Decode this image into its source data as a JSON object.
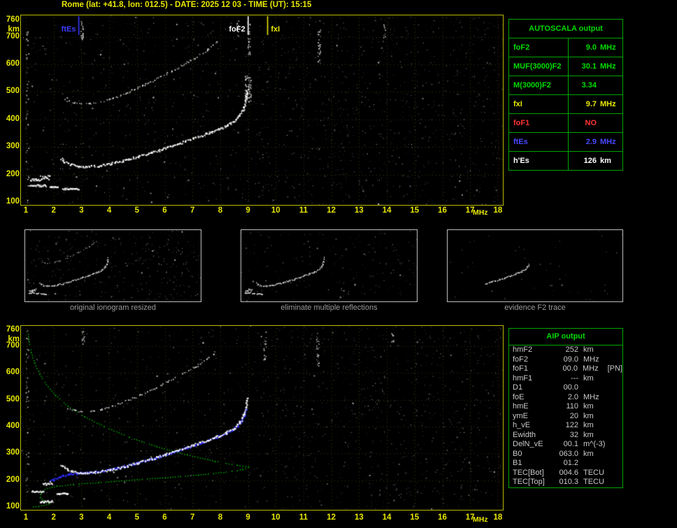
{
  "title": "Rome (lat: +41.8, lon: 012.5) - DATE: 2025 12 03 - TIME (UT): 15:15",
  "autoscala_table": {
    "header": "AUTOSCALA output",
    "rows": [
      {
        "label": "foF2",
        "value": "9.0",
        "unit": "MHz",
        "color": "#00dd00"
      },
      {
        "label": "MUF(3000)F2",
        "value": "30.1",
        "unit": "MHz",
        "color": "#00dd00"
      },
      {
        "label": "M(3000)F2",
        "value": "3.34",
        "unit": "",
        "color": "#00dd00"
      },
      {
        "label": "fxI",
        "value": "9.7",
        "unit": "MHz",
        "color": "#e8e800"
      },
      {
        "label": "foF1",
        "value": "NO",
        "unit": "",
        "color": "#ff3434"
      },
      {
        "label": "ftEs",
        "value": "2.9",
        "unit": "MHz",
        "color": "#4848ff"
      },
      {
        "label": "h'Es",
        "value": "126",
        "unit": "km",
        "color": "#ffffff"
      }
    ]
  },
  "aip_table": {
    "header": "AIP output",
    "rows": [
      {
        "label": "hmF2",
        "value": "252",
        "unit": "km",
        "note": ""
      },
      {
        "label": "foF2",
        "value": "09.0",
        "unit": "MHz",
        "note": ""
      },
      {
        "label": "foF1",
        "value": "00.0",
        "unit": "MHz",
        "note": "[PN]"
      },
      {
        "label": "hmF1",
        "value": "---",
        "unit": "km",
        "note": ""
      },
      {
        "label": "D1",
        "value": "00.0",
        "unit": "",
        "note": ""
      },
      {
        "label": "foE",
        "value": "2.0",
        "unit": "MHz",
        "note": ""
      },
      {
        "label": "hmE",
        "value": "110",
        "unit": "km",
        "note": ""
      },
      {
        "label": "ymE",
        "value": "20",
        "unit": "km",
        "note": ""
      },
      {
        "label": "h_vE",
        "value": "122",
        "unit": "km",
        "note": ""
      },
      {
        "label": "Ewidth",
        "value": "32",
        "unit": "km",
        "note": ""
      },
      {
        "label": "DelN_vE",
        "value": "00.1",
        "unit": "m^(-3)",
        "note": ""
      },
      {
        "label": "B0",
        "value": "063.0",
        "unit": "km",
        "note": ""
      },
      {
        "label": "B1",
        "value": "01.2",
        "unit": "",
        "note": ""
      },
      {
        "label": "TEC[Bot]",
        "value": "004.6",
        "unit": "TECU",
        "note": ""
      },
      {
        "label": "TEC[Top]",
        "value": "010.3",
        "unit": "TECU",
        "note": ""
      }
    ]
  },
  "thumbnails": [
    {
      "caption": "original ionogram resized"
    },
    {
      "caption": "eliminate multiple reflections"
    },
    {
      "caption": "evidence F2 trace"
    }
  ],
  "chart_data": [
    {
      "id": "top-ionogram",
      "type": "scatter",
      "xlabel": "MHz",
      "ylabel": "km",
      "x_range": [
        1,
        18
      ],
      "y_range": [
        100,
        760
      ],
      "x_ticks": [
        1,
        2,
        3,
        4,
        5,
        6,
        7,
        8,
        9,
        10,
        11,
        12,
        13,
        14,
        15,
        16,
        17,
        18
      ],
      "y_ticks": [
        100,
        200,
        300,
        400,
        500,
        600,
        700,
        760
      ],
      "grid": true,
      "markers": [
        {
          "label": "ftEs",
          "f": 2.9,
          "color": "#3c3cff"
        },
        {
          "label": "foF2",
          "f": 9.0,
          "color": "#ffffff"
        },
        {
          "label": "fxI",
          "f": 9.7,
          "color": "#e8e800"
        }
      ],
      "colors": {
        "trace": "#ffffff"
      },
      "traces": {
        "f_trace": [
          [
            2.25,
            260
          ],
          [
            2.4,
            246
          ],
          [
            2.6,
            237
          ],
          [
            2.9,
            231
          ],
          [
            3.2,
            230
          ],
          [
            3.6,
            233
          ],
          [
            4.0,
            240
          ],
          [
            4.5,
            252
          ],
          [
            5.0,
            266
          ],
          [
            5.5,
            281
          ],
          [
            6.0,
            297
          ],
          [
            6.5,
            314
          ],
          [
            7.0,
            332
          ],
          [
            7.5,
            350
          ],
          [
            7.9,
            365
          ],
          [
            8.2,
            379
          ],
          [
            8.5,
            397
          ],
          [
            8.7,
            419
          ],
          [
            8.85,
            448
          ],
          [
            8.93,
            482
          ],
          [
            8.97,
            512
          ]
        ],
        "second_hop": [
          [
            2.4,
            472
          ],
          [
            2.7,
            462
          ],
          [
            3.0,
            457
          ],
          [
            3.3,
            459
          ],
          [
            3.7,
            466
          ],
          [
            4.1,
            478
          ],
          [
            4.6,
            497
          ],
          [
            5.1,
            519
          ],
          [
            5.6,
            543
          ],
          [
            6.1,
            569
          ],
          [
            6.6,
            597
          ],
          [
            7.1,
            626
          ],
          [
            7.5,
            652
          ],
          [
            7.85,
            682
          ]
        ],
        "es_segments": [
          [
            1.12,
            1.72,
            162,
            3
          ],
          [
            1.85,
            2.15,
            157,
            2
          ],
          [
            1.5,
            1.85,
            191,
            6
          ],
          [
            2.3,
            2.9,
            150,
            2
          ],
          [
            1.15,
            1.5,
            183,
            3
          ]
        ],
        "spread": [
          8.88,
          9.1,
          465,
          560
        ]
      },
      "noise": {
        "seed": 20251203,
        "count": 1150,
        "right_extra": 420,
        "columns": [
          [
            3.0,
            690,
            760,
            20
          ],
          [
            9.02,
            630,
            760,
            26
          ],
          [
            11.55,
            610,
            760,
            30
          ],
          [
            1.04,
            100,
            760,
            45
          ],
          [
            8.6,
            700,
            760,
            12
          ],
          [
            13.9,
            680,
            760,
            10
          ]
        ]
      }
    },
    {
      "id": "bottom-ionogram",
      "type": "scatter",
      "xlabel": "MHz",
      "ylabel": "km",
      "x_range": [
        1,
        18
      ],
      "y_range": [
        100,
        760
      ],
      "x_ticks": [
        1,
        2,
        3,
        4,
        5,
        6,
        7,
        8,
        9,
        10,
        11,
        12,
        13,
        14,
        15,
        16,
        17,
        18
      ],
      "y_ticks": [
        100,
        200,
        300,
        400,
        500,
        600,
        700,
        760
      ],
      "grid": true,
      "colors": {
        "trace": "#ffffff",
        "profile": "#00bb00",
        "model": "#2d2dff"
      },
      "traces": {
        "f_trace": [
          [
            2.25,
            260
          ],
          [
            2.4,
            246
          ],
          [
            2.6,
            237
          ],
          [
            2.9,
            231
          ],
          [
            3.2,
            230
          ],
          [
            3.6,
            233
          ],
          [
            4.0,
            240
          ],
          [
            4.5,
            252
          ],
          [
            5.0,
            266
          ],
          [
            5.5,
            281
          ],
          [
            6.0,
            297
          ],
          [
            6.5,
            314
          ],
          [
            7.0,
            332
          ],
          [
            7.5,
            350
          ],
          [
            7.9,
            365
          ],
          [
            8.2,
            379
          ],
          [
            8.5,
            397
          ],
          [
            8.7,
            419
          ],
          [
            8.85,
            448
          ],
          [
            8.93,
            482
          ],
          [
            8.97,
            512
          ]
        ],
        "second_hop": [
          [
            2.4,
            472
          ],
          [
            2.7,
            462
          ],
          [
            3.0,
            457
          ],
          [
            3.3,
            459
          ],
          [
            3.7,
            466
          ],
          [
            4.1,
            478
          ],
          [
            4.6,
            497
          ],
          [
            5.1,
            519
          ],
          [
            5.6,
            543
          ],
          [
            6.1,
            569
          ],
          [
            6.6,
            597
          ],
          [
            7.1,
            626
          ],
          [
            7.5,
            652
          ],
          [
            7.85,
            682
          ]
        ],
        "es_segments": [
          [
            1.5,
            1.95,
            122,
            3
          ],
          [
            1.2,
            1.62,
            160,
            2
          ],
          [
            1.6,
            1.95,
            190,
            5
          ],
          [
            2.1,
            2.5,
            152,
            2
          ]
        ],
        "model_trace": [
          [
            1.85,
            198
          ],
          [
            2.0,
            204
          ],
          [
            2.2,
            214
          ],
          [
            2.5,
            223
          ],
          [
            2.9,
            228
          ],
          [
            3.3,
            230
          ],
          [
            3.8,
            237
          ],
          [
            4.3,
            248
          ],
          [
            4.8,
            261
          ],
          [
            5.3,
            275
          ],
          [
            5.8,
            290
          ],
          [
            6.3,
            306
          ],
          [
            6.8,
            324
          ],
          [
            7.3,
            342
          ],
          [
            7.8,
            360
          ],
          [
            8.2,
            376
          ],
          [
            8.5,
            394
          ],
          [
            8.7,
            415
          ],
          [
            8.85,
            442
          ],
          [
            8.93,
            470
          ]
        ],
        "profile": [
          [
            1.06,
            757
          ],
          [
            1.1,
            718
          ],
          [
            1.18,
            678
          ],
          [
            1.3,
            638
          ],
          [
            1.48,
            598
          ],
          [
            1.72,
            558
          ],
          [
            2.05,
            518
          ],
          [
            2.5,
            478
          ],
          [
            3.1,
            438
          ],
          [
            3.8,
            402
          ],
          [
            4.7,
            362
          ],
          [
            5.7,
            327
          ],
          [
            6.8,
            296
          ],
          [
            7.8,
            272
          ],
          [
            8.6,
            257
          ],
          [
            9.0,
            251
          ],
          [
            8.8,
            242
          ],
          [
            8.2,
            232
          ],
          [
            7.2,
            221
          ],
          [
            6.0,
            211
          ],
          [
            4.8,
            202
          ],
          [
            3.6,
            193
          ],
          [
            2.7,
            186
          ],
          [
            2.1,
            179
          ],
          [
            1.75,
            171
          ],
          [
            1.6,
            162
          ],
          [
            1.52,
            149
          ],
          [
            1.5,
            137
          ],
          [
            1.63,
            125
          ],
          [
            1.82,
            114
          ],
          [
            1.55,
            106
          ],
          [
            1.25,
            102
          ]
        ]
      },
      "noise": {
        "seed": 7151515,
        "count": 1050,
        "right_extra": 380,
        "columns": [
          [
            3.05,
            700,
            760,
            14
          ],
          [
            9.6,
            650,
            760,
            18
          ],
          [
            11.5,
            620,
            760,
            24
          ],
          [
            1.04,
            100,
            760,
            40
          ],
          [
            14.2,
            700,
            760,
            10
          ]
        ]
      }
    },
    {
      "id": "thumb-original",
      "type": "scatter",
      "include": [
        "f_trace",
        "second_hop",
        "es_segments"
      ],
      "noise": {
        "seed": 31,
        "count": 300,
        "right_extra": 70
      }
    },
    {
      "id": "thumb-clean",
      "type": "scatter",
      "include": [
        "f_trace",
        "es_segments"
      ],
      "noise": {
        "seed": 32,
        "count": 170,
        "right_extra": 40
      }
    },
    {
      "id": "thumb-f2",
      "type": "scatter",
      "include": [],
      "traces": {
        "f_trace": [
          [
            4.5,
            252
          ],
          [
            5.0,
            266
          ],
          [
            5.5,
            281
          ],
          [
            6.0,
            297
          ],
          [
            6.5,
            314
          ],
          [
            7.0,
            332
          ],
          [
            7.5,
            350
          ],
          [
            7.9,
            365
          ],
          [
            8.2,
            379
          ],
          [
            8.5,
            397
          ],
          [
            8.7,
            419
          ],
          [
            8.85,
            448
          ]
        ]
      },
      "noise": {
        "seed": 33,
        "count": 60
      }
    }
  ]
}
